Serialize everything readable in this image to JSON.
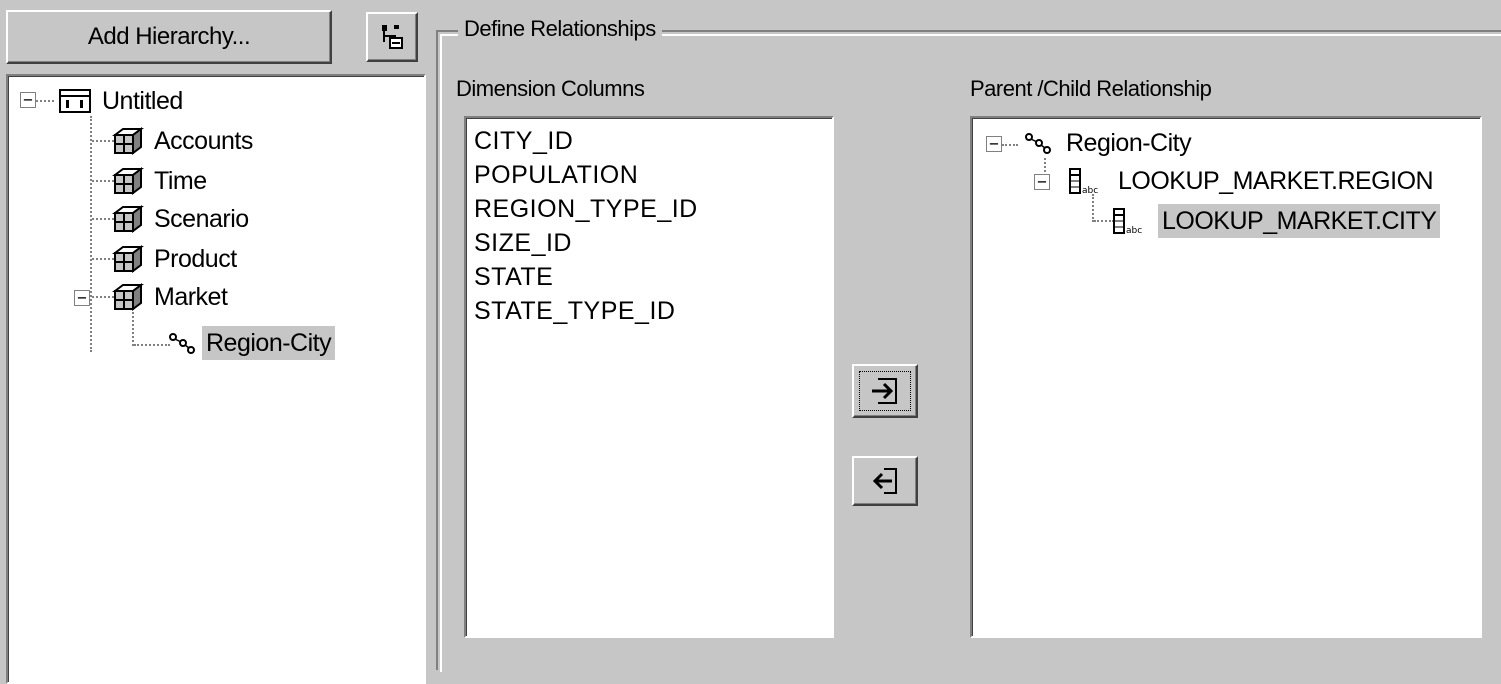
{
  "toolbar": {
    "add_hierarchy_label": "Add Hierarchy..."
  },
  "hierarchy_tree": {
    "root": {
      "label": "Untitled",
      "icon": "database-icon"
    },
    "dimensions": [
      {
        "label": "Accounts",
        "icon": "dimension-cube-icon"
      },
      {
        "label": "Time",
        "icon": "dimension-cube-icon"
      },
      {
        "label": "Scenario",
        "icon": "dimension-cube-icon"
      },
      {
        "label": "Product",
        "icon": "dimension-cube-icon"
      },
      {
        "label": "Market",
        "icon": "dimension-cube-icon",
        "expanded": true
      }
    ],
    "hierarchy": {
      "label": "Region-City",
      "icon": "hierarchy-icon",
      "selected": true
    }
  },
  "define_relationships": {
    "title": "Define Relationships",
    "dimension_columns_label": "Dimension Columns",
    "dimension_columns": [
      "CITY_ID",
      "POPULATION",
      "REGION_TYPE_ID",
      "SIZE_ID",
      "STATE",
      "STATE_TYPE_ID"
    ],
    "parent_child_label": "Parent /Child Relationship",
    "parent_child_tree": {
      "root": "Region-City",
      "level1": "LOOKUP_MARKET.REGION",
      "level2": "LOOKUP_MARKET.CITY"
    }
  },
  "colors": {
    "dialog_bg": "#c6c6c6",
    "field_bg": "#ffffff",
    "selection_bg": "#c6c6c6"
  }
}
